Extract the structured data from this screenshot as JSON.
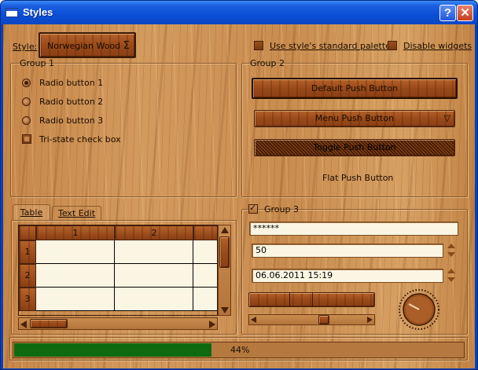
{
  "window": {
    "title": "Styles"
  },
  "top": {
    "style_label": "Style:",
    "style_value": "Norwegian Wood",
    "std_palette_label": "Use style's standard palette",
    "disable_widgets_label": "Disable widgets"
  },
  "group1": {
    "title": "Group 1",
    "radios": [
      "Radio button 1",
      "Radio button 2",
      "Radio button 3"
    ],
    "tristate_label": "Tri-state check box"
  },
  "group2": {
    "title": "Group 2",
    "default_btn": "Default Push Button",
    "menu_btn": "Menu Push Button",
    "toggle_btn": "Toggle Push Button",
    "flat_btn": "Flat Push Button"
  },
  "tabs": {
    "table": "Table",
    "text_edit": "Text Edit"
  },
  "table": {
    "columns": [
      "1",
      "2"
    ],
    "rows": [
      "1",
      "2",
      "3"
    ]
  },
  "group3": {
    "title": "Group 3",
    "password": "******",
    "spin_value": "50",
    "datetime": "06.06.2011 15:19"
  },
  "progress": {
    "value": 0.44,
    "label": "44%",
    "color": "#0f6a0f"
  }
}
